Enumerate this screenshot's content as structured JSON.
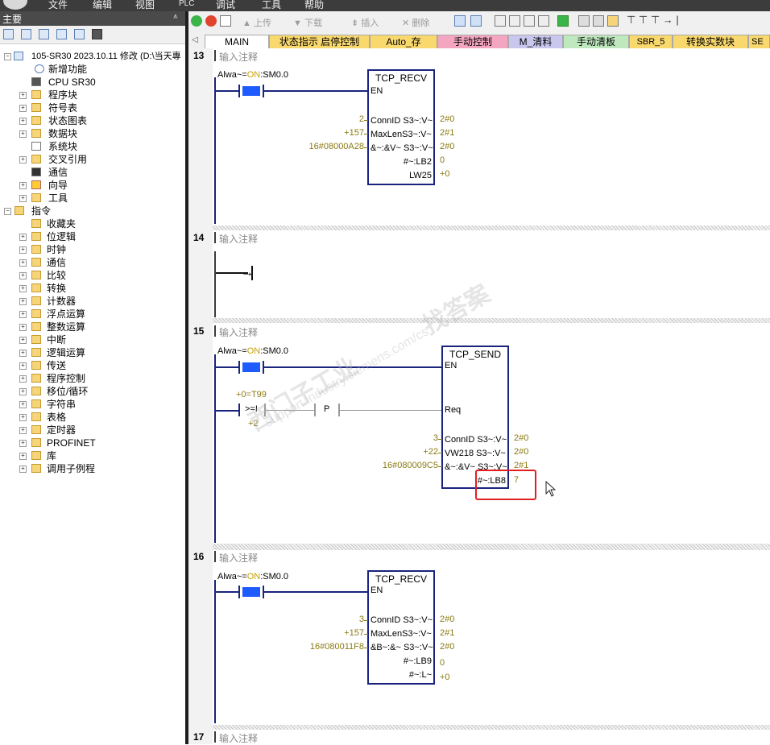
{
  "menubar": {
    "items": [
      "文件",
      "编辑",
      "视图",
      "PLC",
      "调试",
      "工具",
      "帮助"
    ]
  },
  "leftpane": {
    "title": "主要",
    "tree": [
      {
        "label": "105-SR30 2023.10.11 修改 (D:\\当天專"
      },
      {
        "label": "新增功能"
      },
      {
        "label": "CPU SR30"
      },
      {
        "label": "程序块"
      },
      {
        "label": "符号表"
      },
      {
        "label": "状态图表"
      },
      {
        "label": "数据块"
      },
      {
        "label": "系统块"
      },
      {
        "label": "交叉引用"
      },
      {
        "label": "通信"
      },
      {
        "label": "向导"
      },
      {
        "label": "工具"
      },
      {
        "label": "指令"
      },
      {
        "label": "收藏夹"
      },
      {
        "label": "位逻辑"
      },
      {
        "label": "时钟"
      },
      {
        "label": "通信"
      },
      {
        "label": "比较"
      },
      {
        "label": "转换"
      },
      {
        "label": "计数器"
      },
      {
        "label": "浮点运算"
      },
      {
        "label": "整数运算"
      },
      {
        "label": "中断"
      },
      {
        "label": "逻辑运算"
      },
      {
        "label": "传送"
      },
      {
        "label": "程序控制"
      },
      {
        "label": "移位/循环"
      },
      {
        "label": "字符串"
      },
      {
        "label": "表格"
      },
      {
        "label": "定时器"
      },
      {
        "label": "PROFINET"
      },
      {
        "label": "库"
      },
      {
        "label": "调用子例程"
      }
    ]
  },
  "toolbar": {
    "upload": "上传",
    "download": "下载",
    "insert": "插入",
    "delete": "删除"
  },
  "tabs": [
    {
      "label": "MAIN"
    },
    {
      "label": "状态指示 启停控制"
    },
    {
      "label": "Auto_存"
    },
    {
      "label": "手动控制"
    },
    {
      "label": "M_清料"
    },
    {
      "label": "手动清板"
    },
    {
      "label": "SBR_5"
    },
    {
      "label": "转换实数块"
    },
    {
      "label": "SE"
    }
  ],
  "networks": [
    {
      "num": "13",
      "comment": "输入注释",
      "contact_label_pre": "Alwa~=",
      "contact_on": "ON",
      "contact_label_post": ":SM0.0",
      "block": {
        "title": "TCP_RECV",
        "en": "EN",
        "pins": [
          {
            "name": "ConnID S3~:V~",
            "in": "2",
            "out": "2#0"
          },
          {
            "name": "MaxLenS3~:V~",
            "in": "+157",
            "out": "2#1"
          },
          {
            "name": "&~:&V~ S3~:V~",
            "in": "16#08000A28",
            "out": "2#0"
          }
        ],
        "outs": [
          {
            "name": "#~:LB2",
            "val": "0"
          },
          {
            "name": "LW25",
            "val": "+0"
          }
        ]
      }
    },
    {
      "num": "14",
      "comment": "输入注释"
    },
    {
      "num": "15",
      "comment": "输入注释",
      "contact_label_pre": "Alwa~=",
      "contact_on": "ON",
      "contact_label_post": ":SM0.0",
      "compare": {
        "top": "+0=T99",
        "op": ">=I",
        "bottom": "+2",
        "pulse": "P"
      },
      "block": {
        "title": "TCP_SEND",
        "en": "EN",
        "req": "Req",
        "pins": [
          {
            "name": "ConnID S3~:V~",
            "in": "3",
            "out": "2#0"
          },
          {
            "name": "VW218 S3~:V~",
            "in": "+22",
            "out": "2#0"
          },
          {
            "name": "&~:&V~ S3~:V~",
            "in": "16#080009C5",
            "out": "2#1"
          }
        ],
        "outs": [
          {
            "name": "#~:LB8",
            "val": "7"
          }
        ]
      }
    },
    {
      "num": "16",
      "comment": "输入注释",
      "contact_label_pre": "Alwa~=",
      "contact_on": "ON",
      "contact_label_post": ":SM0.0",
      "block": {
        "title": "TCP_RECV",
        "en": "EN",
        "pins": [
          {
            "name": "ConnID S3~:V~",
            "in": "3",
            "out": "2#0"
          },
          {
            "name": "MaxLenS3~:V~",
            "in": "+157",
            "out": "2#1"
          },
          {
            "name": "&B~:&~ S3~:V~",
            "in": "16#080011F8",
            "out": "2#0"
          }
        ],
        "outs": [
          {
            "name": "#~:LB9",
            "val": "0"
          },
          {
            "name": "#~:L~",
            "val": "+0"
          }
        ]
      }
    },
    {
      "num": "17",
      "comment": "输入注释"
    }
  ],
  "watermark": {
    "line1": "西门子工业",
    "line2": "找答案",
    "line3": "support.industry.siemens.com/cs"
  },
  "colors": {
    "wire": "#1a237e",
    "contact_fill": "#1e5bff",
    "value": "#8a7a10",
    "highlight": "#e02020",
    "on": "#c8a000"
  }
}
